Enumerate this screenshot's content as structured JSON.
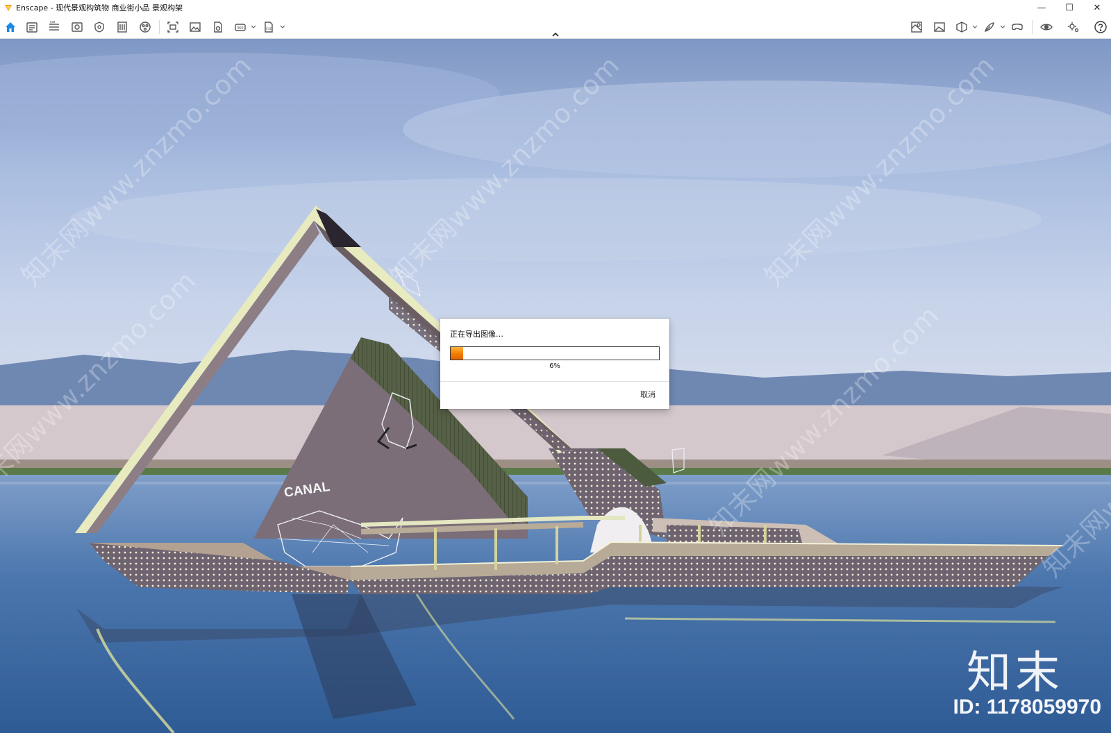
{
  "window": {
    "app_name": "Enscape",
    "title": "Enscape - 现代景观构筑物 商业街小品 景观构架",
    "controls": {
      "minimize": "—",
      "maximize": "☐",
      "close": "✕"
    }
  },
  "toolbar": {
    "left_icons": [
      "home-icon",
      "asset-library-icon",
      "bim-icon",
      "views-icon",
      "visual-settings-icon",
      "building-icon",
      "materials-icon",
      "screenshot-icon",
      "image-export-icon",
      "batch-render-icon",
      "panorama-icon",
      "exe-export-icon"
    ],
    "right_icons": [
      "map-icon",
      "image-settings-icon",
      "cube-view-icon",
      "feather-icon",
      "vr-headset-icon",
      "eye-icon",
      "settings-icon",
      "help-icon"
    ]
  },
  "dialog": {
    "title": "正在导出图像…",
    "progress_percent": 6,
    "progress_label": "6%",
    "cancel_label": "取消"
  },
  "scene": {
    "watermark_text": "知末网www.znzmo.com",
    "sign_text": "CANAL",
    "brand_mark": "知末",
    "id_label": "ID: 1178059970"
  },
  "colors": {
    "accent": "#f07a00",
    "toolbar_icon": "#555555",
    "home_icon": "#1e88e5"
  }
}
